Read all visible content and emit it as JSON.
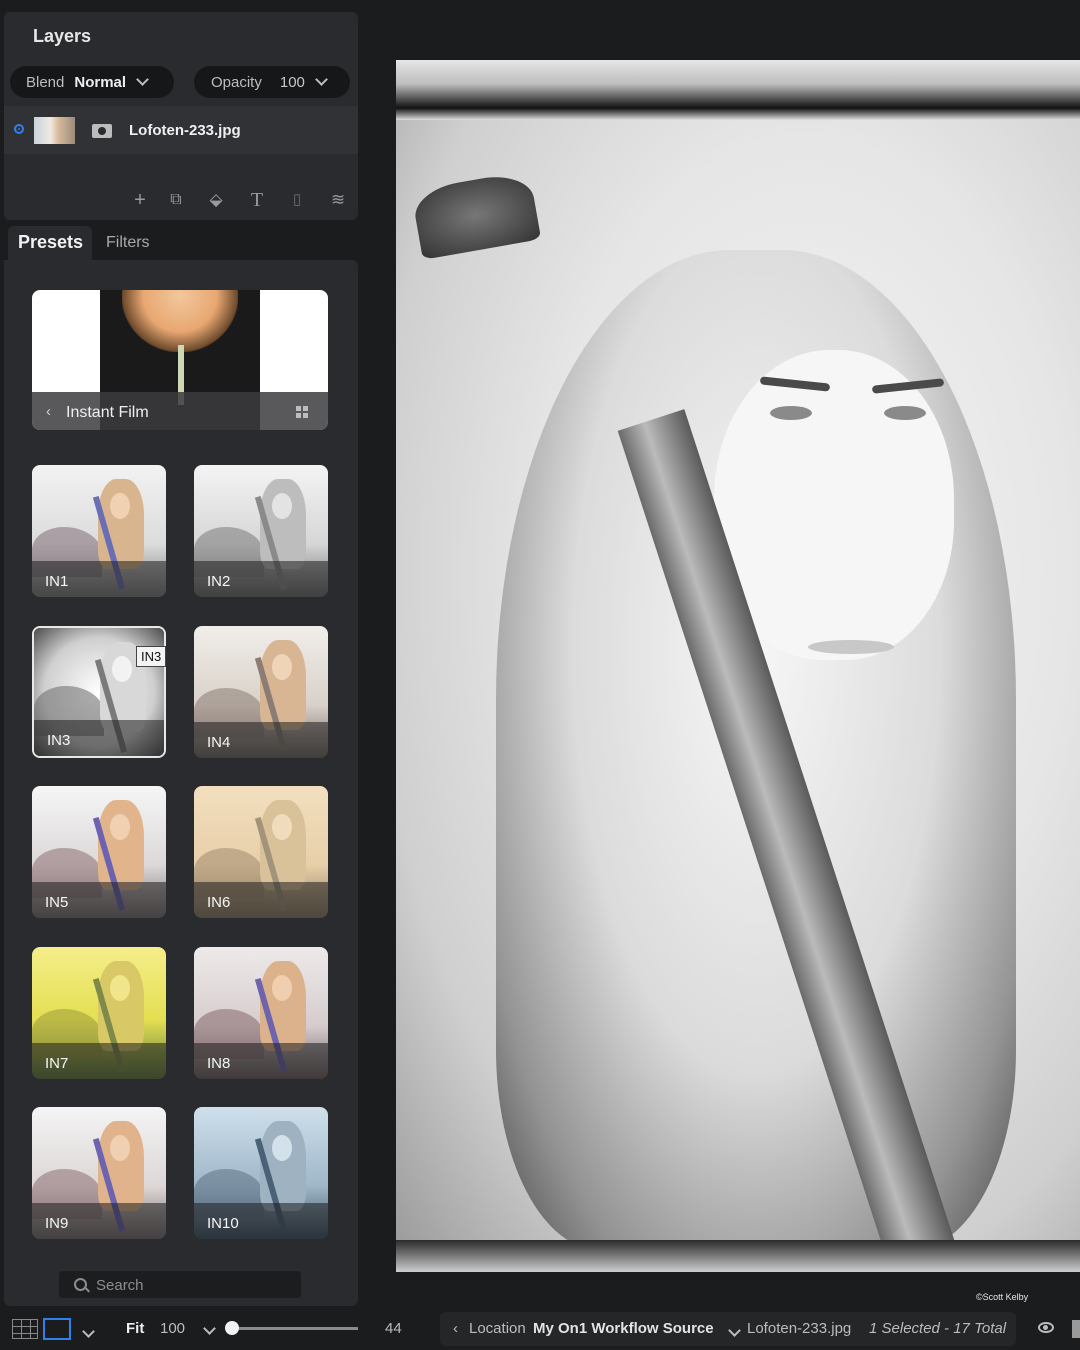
{
  "layers": {
    "title": "Layers",
    "blend_label": "Blend",
    "blend_value": "Normal",
    "opacity_label": "Opacity",
    "opacity_value": "100",
    "layer_name": "Lofoten-233.jpg"
  },
  "tabs": {
    "presets": "Presets",
    "filters": "Filters"
  },
  "category": {
    "back": "‹",
    "label": "Instant Film"
  },
  "presets": [
    {
      "label": "IN1"
    },
    {
      "label": "IN2"
    },
    {
      "label": "IN3"
    },
    {
      "label": "IN4"
    },
    {
      "label": "IN5"
    },
    {
      "label": "IN6"
    },
    {
      "label": "IN7"
    },
    {
      "label": "IN8"
    },
    {
      "label": "IN9"
    },
    {
      "label": "IN10"
    }
  ],
  "tooltip": "IN3",
  "search_placeholder": "Search",
  "credit": "©Scott Kelby",
  "bottombar": {
    "fit": "Fit",
    "zoom": "100",
    "size": "44",
    "back": "‹",
    "location_label": "Location",
    "location_source": "My On1 Workflow Source",
    "file": "Lofoten-233.jpg",
    "count": "1 Selected - 17 Total"
  },
  "colors": {
    "accent": "#2f80ed",
    "panel": "#2a2b2e",
    "background": "#1b1c1e"
  }
}
